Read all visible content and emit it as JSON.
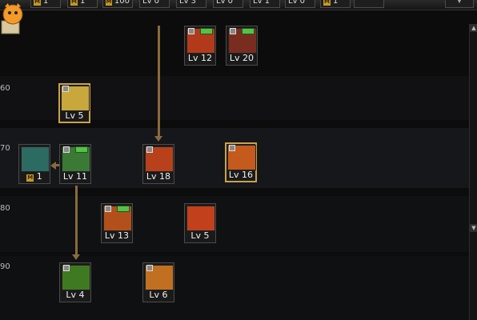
{
  "topbar": {
    "items": [
      {
        "coin": "M",
        "value": "1"
      },
      {
        "coin": "M",
        "value": "1"
      },
      {
        "coin": "M",
        "value": "100"
      },
      {
        "label": "Lv 0"
      },
      {
        "label": "Lv 3"
      },
      {
        "label": "Lv 0"
      },
      {
        "label": "Lv 1"
      },
      {
        "label": "Lv 0"
      },
      {
        "coin": "M",
        "value": "1"
      },
      {
        "label": ""
      }
    ]
  },
  "rows": [
    {
      "label": "60"
    },
    {
      "label": "70"
    },
    {
      "label": "80"
    },
    {
      "label": "90"
    }
  ],
  "skills": [
    {
      "level": "Lv 12",
      "color": "#b23a1a"
    },
    {
      "level": "Lv 20",
      "color": "#7a2d1f"
    },
    {
      "level": "Lv 5",
      "color": "#c8a73c"
    },
    {
      "level": "Lv 18",
      "color": "#b8401a"
    },
    {
      "level": "Lv 16",
      "color": "#c45a1c"
    },
    {
      "level": "1",
      "coin": "M",
      "color": "#2b6b61"
    },
    {
      "level": "Lv 11",
      "color": "#3a7a35"
    },
    {
      "level": "Lv 13",
      "color": "#b2501c"
    },
    {
      "level": "Lv 5",
      "color": "#c2401c"
    },
    {
      "level": "Lv 4",
      "color": "#3f7a22"
    },
    {
      "level": "Lv 6",
      "color": "#c07020"
    }
  ],
  "colors": {
    "background": "#0c0c0d",
    "frame": "#4b4b4b",
    "highlight_frame": "#c9a24a",
    "arrow": "#8a6a3c"
  }
}
